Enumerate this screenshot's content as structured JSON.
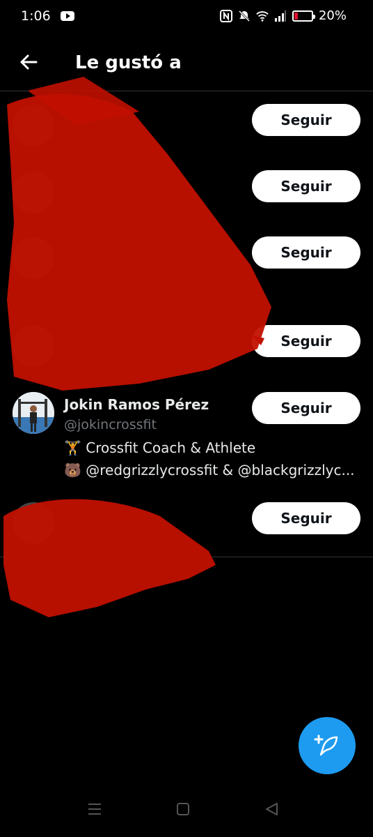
{
  "status": {
    "time": "1:06",
    "battery": "20%",
    "battery_level_pct": 20
  },
  "header": {
    "title": "Le gustó a"
  },
  "users": [
    {
      "name": "",
      "handle": "",
      "bio": "",
      "follow_label": "Seguir"
    },
    {
      "name": "",
      "handle": "",
      "bio": "",
      "follow_label": "Seguir"
    },
    {
      "name": "",
      "handle": "",
      "bio": "",
      "follow_label": "Seguir"
    },
    {
      "name": "",
      "handle": "",
      "bio": "",
      "follow_label": "Seguir"
    },
    {
      "name": "Jokin Ramos Pérez",
      "handle": "@jokincrossfit",
      "bio_line1": "🏋️ Crossfit Coach & Athlete",
      "bio_line2": "🐻 @redgrizzlycrossfit & @blackgrizzlyc...",
      "follow_label": "Seguir"
    },
    {
      "name": "",
      "handle": "",
      "bio": "",
      "follow_label": "Seguir"
    }
  ],
  "colors": {
    "accent": "#1d9bf0",
    "scribble": "#c11000",
    "background": "#000000"
  },
  "icons": {
    "back": "arrow-left-icon",
    "compose": "compose-tweet-icon",
    "nav_recent": "menu-lines-icon",
    "nav_home": "square-icon",
    "nav_back": "triangle-back-icon"
  }
}
